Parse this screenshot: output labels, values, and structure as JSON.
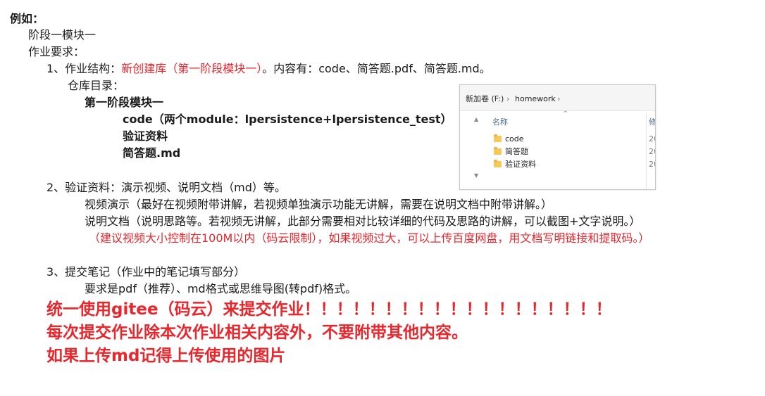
{
  "heading": "例如：",
  "stage": "阶段一模块一",
  "requirement_title": "作业要求：",
  "item1": {
    "label": "1、作业结构：",
    "repo": "新创建库（第一阶段模块一）",
    "contents": "。内容有：code、简答题.pdf、简答题.md。",
    "repo_dir_label": "仓库目录：",
    "tree": {
      "root": "第一阶段模块一",
      "code": "code（两个module：lpersistence+lpersistence_test）",
      "verify": "验证资料",
      "answers": "简答题.md"
    }
  },
  "item2": {
    "label": "2、验证资料：演示视频、说明文档（md）等。",
    "video": "视频演示（最好在视频附带讲解，若视频单独演示功能无讲解，需要在说明文档中附带讲解。）",
    "doc": "说明文档（说明思路等。若视频无讲解，此部分需要相对比较详细的代码及思路的讲解，可以截图+文字说明。）",
    "note": "（建议视频大小控制在100M以内（码云限制），如果视频过大，可以上传百度网盘，用文档写明链接和提取码。）"
  },
  "item3": {
    "label": "3、提交笔记（作业中的笔记填写部分）",
    "format": "要求是pdf（推荐）、md格式或思维导图(转pdf)格式。"
  },
  "emphasis": {
    "line1": "统一使用gitee（码云）来提交作业！！！！！！！！！！！！！！！！！！！",
    "line2": "每次提交作业除本次作业相关内容外，不要附带其他内容。",
    "line3": "如果上传md记得上传使用的图片"
  },
  "explorer": {
    "path_drive": "新加卷 (F:)",
    "path_sep": "›",
    "path_folder": "homework",
    "path_sep2": "›",
    "col_name": "名称",
    "col_modified": "修",
    "rows": [
      {
        "name": "code",
        "date": "20"
      },
      {
        "name": "简答题",
        "date": "20"
      },
      {
        "name": "验证资料",
        "date": "20"
      }
    ]
  },
  "colors": {
    "red": "#e8262c",
    "folder": "#f5c85a"
  }
}
